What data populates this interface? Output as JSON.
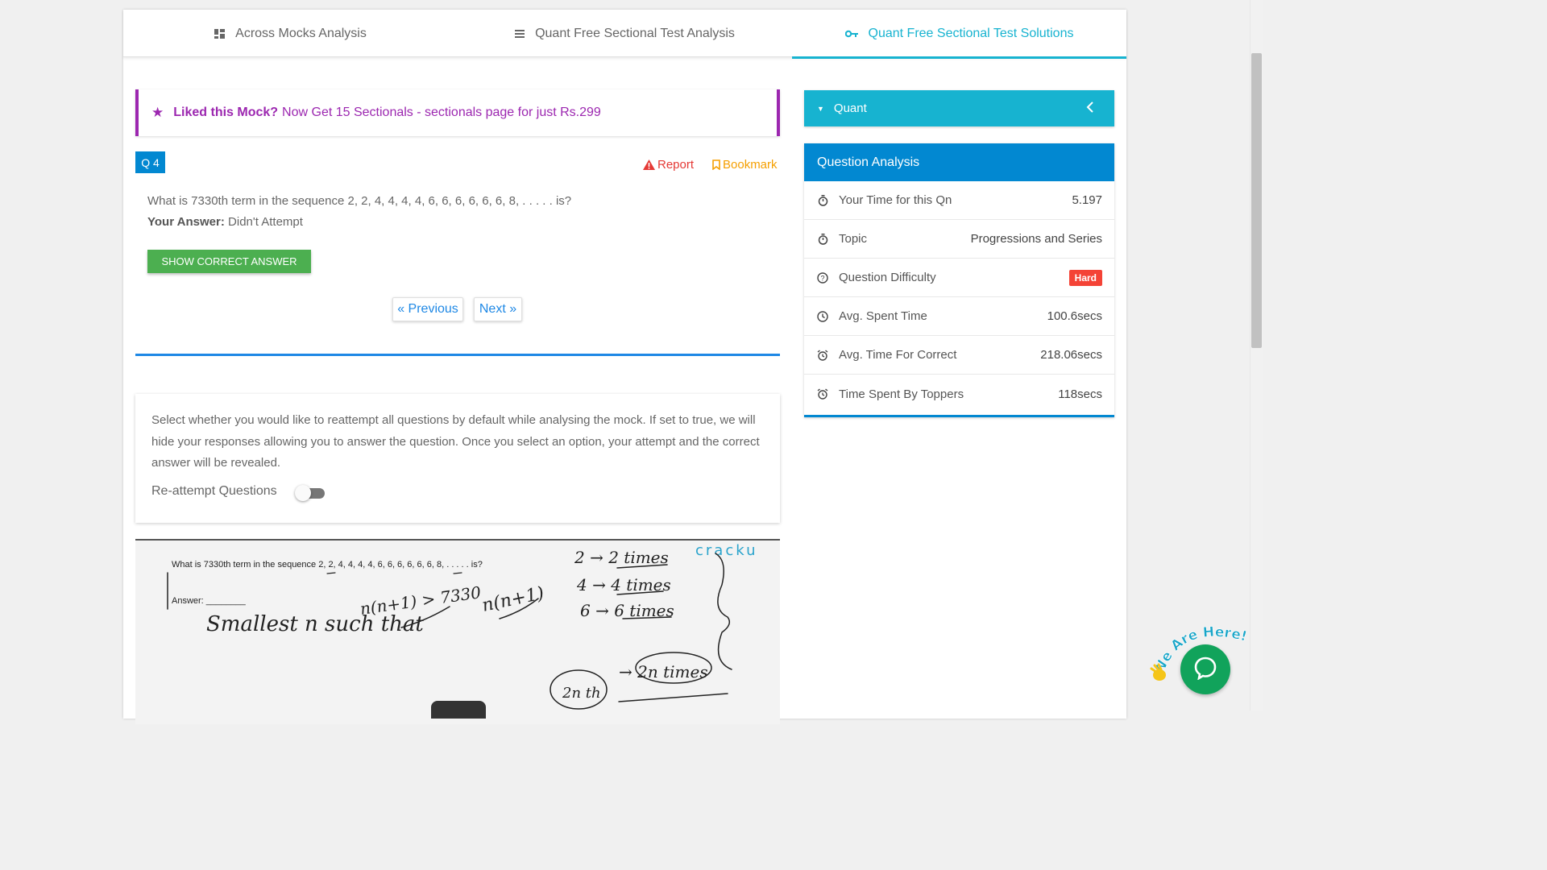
{
  "tabs": [
    {
      "label": "Across Mocks Analysis",
      "icon": "dashboard-icon"
    },
    {
      "label": "Quant Free Sectional Test Analysis",
      "icon": "list-icon"
    },
    {
      "label": "Quant Free Sectional Test Solutions",
      "icon": "key-icon",
      "active": true
    }
  ],
  "promo": {
    "bold": "Liked this Mock?",
    "text": "Now Get 15 Sectionals - sectionals page for just Rs.299",
    "color": "#9c27b0"
  },
  "question": {
    "badge": "Q 4",
    "report_label": "Report",
    "bookmark_label": "Bookmark",
    "text": "What is 7330th term in the sequence 2, 2, 4, 4, 4, 4, 6, 6, 6, 6, 6, 6, 8, . . . . . is?",
    "your_answer_label": "Your Answer:",
    "your_answer_value": "Didn't Attempt",
    "show_answer_button": "SHOW CORRECT ANSWER",
    "prev_label": "« Previous",
    "next_label": "Next »"
  },
  "reattempt": {
    "description": "Select whether you would like to reattempt all questions by default while analysing the mock. If set to true, we will hide your responses allowing you to answer the question. Once you select an option, your attempt and the correct answer will be revealed.",
    "label": "Re-attempt Questions",
    "enabled": false
  },
  "solution_image": {
    "question": "What is 7330th term in the sequence 2, 2, 4, 4, 4, 4, 6, 6, 6, 6, 6, 6, 8, . . . . . is?",
    "answer_label": "Answer: ________",
    "logo": "cracku",
    "handwriting": [
      "Smallest n such that",
      "n(n+1) > 7330",
      "n(n+1)",
      "2 → 2 times",
      "4 → 4 times",
      "6 → 6 times",
      "2n th",
      "→ 2n times"
    ]
  },
  "sidebar": {
    "section_label": "Quant",
    "analysis_title": "Question Analysis",
    "rows": [
      {
        "label": "Your Time for this Qn",
        "value": "5.197",
        "icon": "stopwatch-icon"
      },
      {
        "label": "Topic",
        "value": "Progressions and Series",
        "icon": "stopwatch-icon"
      },
      {
        "label": "Question Difficulty",
        "value": "Hard",
        "icon": "question-circle-icon",
        "badge": true
      },
      {
        "label": "Avg. Spent Time",
        "value": "100.6secs",
        "icon": "clock-icon"
      },
      {
        "label": "Avg. Time For Correct",
        "value": "218.06secs",
        "icon": "alarm-icon"
      },
      {
        "label": "Time Spent By Toppers",
        "value": "118secs",
        "icon": "alarm-icon"
      }
    ]
  },
  "chat": {
    "label": "We Are Here!"
  },
  "colors": {
    "accent": "#17b3d0",
    "primary": "#0288d1",
    "success": "#4caf50",
    "danger": "#f44336",
    "warning": "#f59f00"
  }
}
